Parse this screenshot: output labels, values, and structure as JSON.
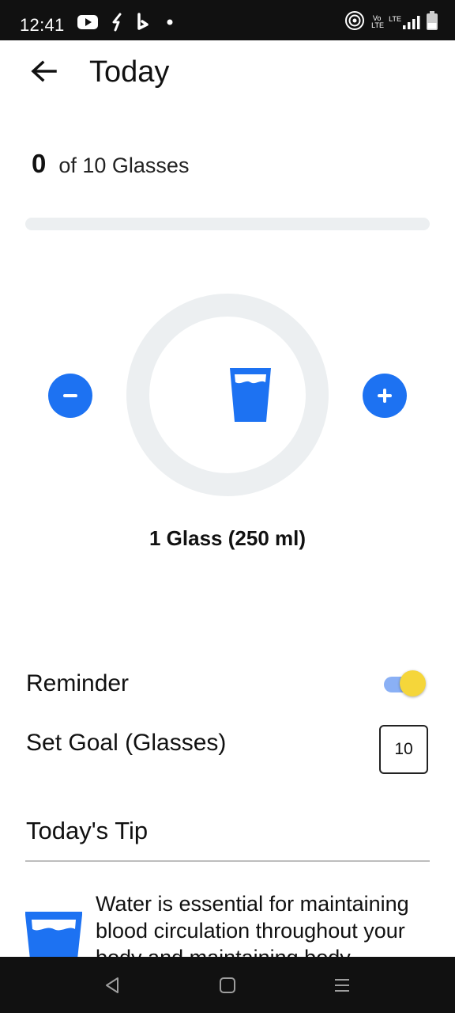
{
  "status_bar": {
    "time": "12:41",
    "icons": [
      "youtube-icon",
      "zomato-icon",
      "bing-icon",
      "notification-dot-icon",
      "hotspot-icon",
      "volte-icon",
      "lte-signal-icon",
      "battery-icon"
    ],
    "volte_text": "Vo LTE",
    "lte_text": "LTE"
  },
  "header": {
    "back_icon": "arrow-left-icon",
    "title": "Today"
  },
  "intake": {
    "count": "0",
    "goal_text": "of 10 Glasses",
    "progress": 0
  },
  "glass": {
    "icon": "water-glass-icon",
    "size_label": "1 Glass (250 ml)",
    "minus_icon": "minus-icon",
    "plus_icon": "plus-icon"
  },
  "settings": {
    "reminder_label": "Reminder",
    "reminder_on": true,
    "goal_label": "Set Goal (Glasses)",
    "goal_value": "10"
  },
  "tip": {
    "title": "Today's Tip",
    "icon": "water-glass-icon",
    "text": "Water is essential for maintaining blood circulation throughout your body and maintaining body"
  },
  "nav_bar": {
    "icons": [
      "back-triangle-icon",
      "home-square-icon",
      "menu-lines-icon"
    ]
  },
  "colors": {
    "accent": "#1d72f2",
    "ring": "#eceff1",
    "toggle_thumb": "#f5d63a",
    "toggle_track": "#8ab0f5"
  }
}
